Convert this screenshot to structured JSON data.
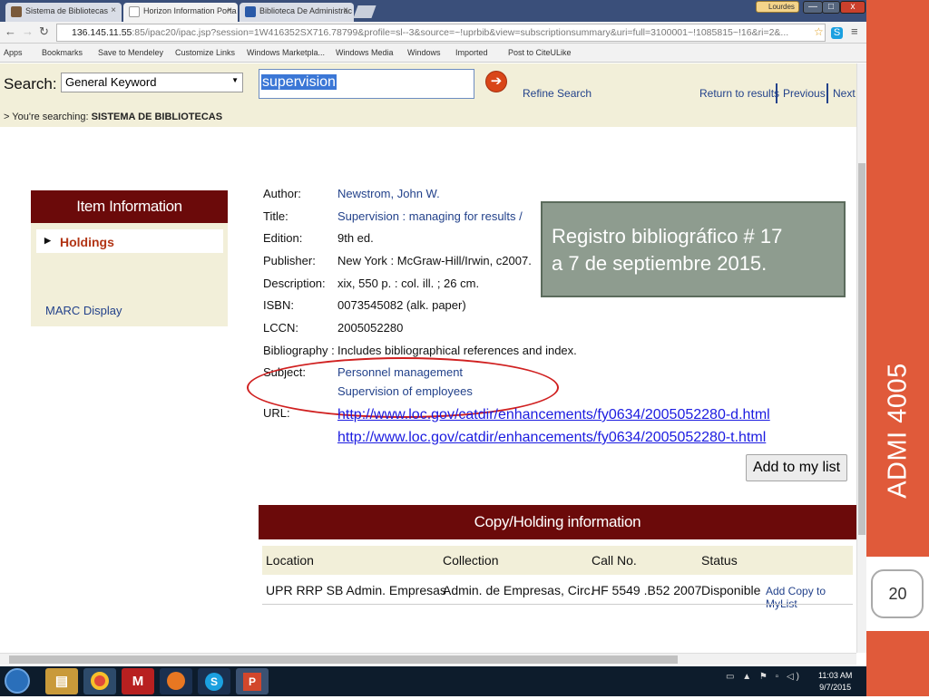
{
  "tabs": [
    {
      "label": "Sistema de Bibliotecas",
      "close": "×"
    },
    {
      "label": "Horizon Information Porta",
      "close": "×"
    },
    {
      "label": "Biblioteca De Administrac",
      "close": "×"
    }
  ],
  "window": {
    "user": "Lourdes",
    "minimize": "—",
    "maximize": "□",
    "close": "x"
  },
  "omnibox": {
    "host": "136.145.11.55",
    "path": ":85/ipac20/ipac.jsp?session=1W416352SX716.78799&profile=sl--3&source=~!uprbib&view=subscriptionsummary&uri=full=3100001~!1085815~!16&ri=2&..."
  },
  "bookmarks": [
    "Apps",
    "Bookmarks",
    "Save to Mendeley",
    "Customize Links",
    "Windows Marketpla...",
    "Windows Media",
    "Windows",
    "Imported",
    "Post to CiteULike"
  ],
  "search": {
    "label": "Search:",
    "type": "General Keyword",
    "query": "supervision",
    "refine": "Refine Search",
    "return": "Return to results",
    "previous": "Previous",
    "next": "Next",
    "searching_prefix": "> You're searching:",
    "searching_lib": "SISTEMA DE BIBLIOTECAS"
  },
  "side": {
    "title": "Item Information",
    "holdings": "Holdings",
    "marc": "MARC Display"
  },
  "record": {
    "author_label": "Author:",
    "author": "Newstrom, John W.",
    "title_label": "Title:",
    "title": "Supervision : managing for results /",
    "edition_label": "Edition:",
    "edition": "9th ed.",
    "publisher_label": "Publisher:",
    "publisher": "New York : McGraw-Hill/Irwin, c2007.",
    "description_label": "Description:",
    "description": "xix, 550 p. : col. ill. ; 26 cm.",
    "isbn_label": "ISBN:",
    "isbn": "0073545082 (alk. paper)",
    "lccn_label": "LCCN:",
    "lccn": "2005052280",
    "bibliography_label": "Bibliography :",
    "bibliography": "Includes bibliographical references and index.",
    "subject_label": "Subject:",
    "subject1": "Personnel management",
    "subject2": "Supervision of employees",
    "url_label": "URL:",
    "url1": "http://www.loc.gov/catdir/enhancements/fy0634/2005052280-d.html",
    "url2": "http://www.loc.gov/catdir/enhancements/fy0634/2005052280-t.html"
  },
  "add_to_list": "Add to my list",
  "copy": {
    "title": "Copy/Holding information",
    "headers": [
      "Location",
      "Collection",
      "Call No.",
      "Status"
    ],
    "row": [
      "UPR RRP SB Admin. Empresas",
      "Admin. de Empresas, Circ.",
      "HF 5549 .B52 2007",
      "Disponible"
    ],
    "add": "Add Copy to MyList"
  },
  "callout": {
    "line1": "Registro bibliográfico # 17",
    "line2": "a 7 de septiembre 2015."
  },
  "slide": {
    "course": "ADMI 4005",
    "page": "20"
  },
  "taskbar": {
    "time": "11:03 AM",
    "date": "9/7/2015",
    "apps": [
      "explorer-icon",
      "chrome-icon",
      "m-icon",
      "firefox-icon",
      "skype-icon",
      "powerpoint-icon"
    ]
  },
  "colors": {
    "maroon": "#6b0a0a",
    "tan": "#f2efd9",
    "link": "#23428b",
    "slide_orange": "#e05a3a",
    "callout": "#8e9c8f"
  }
}
